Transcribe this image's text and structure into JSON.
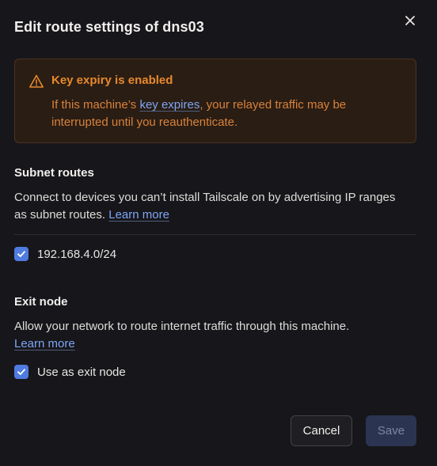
{
  "dialog": {
    "title": "Edit route settings of dns03",
    "close_icon": "close-icon"
  },
  "warning": {
    "icon": "warning-triangle-icon",
    "title": "Key expiry is enabled",
    "body_prefix": "If this machine’s ",
    "body_link": "key expires",
    "body_suffix": ", your relayed traffic may be interrupted until you reauthenticate.",
    "color": "#e8892c"
  },
  "subnet": {
    "heading": "Subnet routes",
    "description": "Connect to devices you can’t install Tailscale on by advertising IP ranges as subnet routes.",
    "learn_more": "Learn more",
    "routes": [
      {
        "label": "192.168.4.0/24",
        "checked": true
      }
    ]
  },
  "exit_node": {
    "heading": "Exit node",
    "description": "Allow your network to route internet traffic through this machine.",
    "learn_more": "Learn more",
    "option_label": "Use as exit node",
    "checked": true
  },
  "footer": {
    "cancel_label": "Cancel",
    "save_label": "Save"
  },
  "colors": {
    "accent": "#4f7be0",
    "link": "#7ea6f5",
    "background": "#17161a"
  }
}
